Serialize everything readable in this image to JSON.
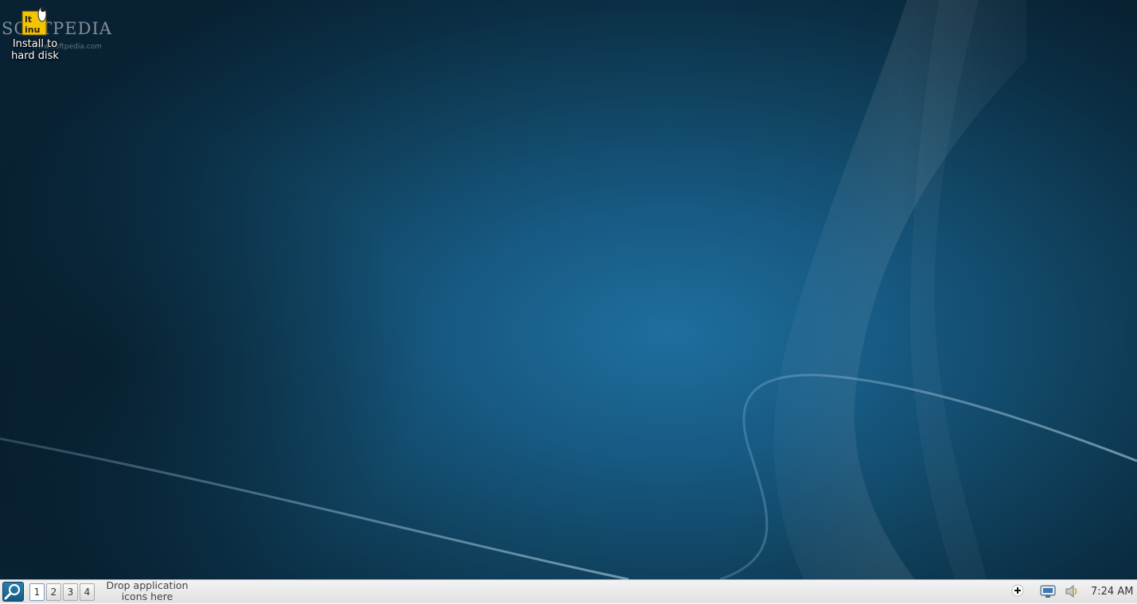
{
  "desktop": {
    "icons": [
      {
        "label": "Install to hard disk",
        "icon": "install-linux-icon"
      }
    ],
    "watermark": {
      "text": "SOFTPEDIA",
      "sub": "www.softpedia.com"
    }
  },
  "taskbar": {
    "start_icon": "search-icon",
    "pager": {
      "desktops": [
        "1",
        "2",
        "3",
        "4"
      ],
      "active": "1"
    },
    "launcher_hint": "Drop application icons here",
    "tray": {
      "icons": [
        "add-icon",
        "network-icon",
        "volume-icon"
      ],
      "clock": "7:24 AM"
    }
  }
}
